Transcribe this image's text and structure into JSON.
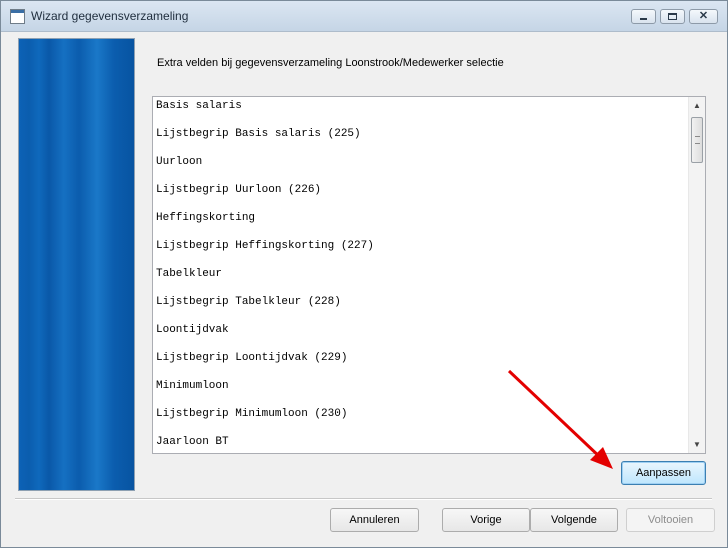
{
  "window": {
    "title": "Wizard gegevensverzameling"
  },
  "caption": "Extra velden bij gegevensverzameling Loonstrook/Medewerker selectie",
  "fields": [
    "Basis salaris",
    "Lijstbegrip Basis salaris (225)",
    "Uurloon",
    "Lijstbegrip Uurloon (226)",
    "Heffingskorting",
    "Lijstbegrip Heffingskorting (227)",
    "Tabelkleur",
    "Lijstbegrip Tabelkleur (228)",
    "Loontijdvak",
    "Lijstbegrip Loontijdvak (229)",
    "Minimumloon",
    "Lijstbegrip Minimumloon (230)",
    "Jaarloon BT"
  ],
  "buttons": {
    "adjust": "Aanpassen",
    "cancel": "Annuleren",
    "previous": "Vorige",
    "next": "Volgende",
    "finish": "Voltooien"
  },
  "colors": {
    "side_panel": "#0b5dae",
    "annotation_arrow": "#e30000"
  }
}
